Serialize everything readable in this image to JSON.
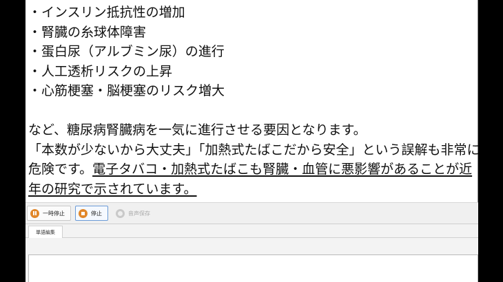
{
  "document": {
    "bullets": [
      "・インスリン抵抗性の増加",
      "・腎臓の糸球体障害",
      "・蛋白尿（アルブミン尿）の進行",
      "・人工透析リスクの上昇",
      "・心筋梗塞・脳梗塞のリスク増大"
    ],
    "paragraph_line1": "など、糖尿病腎臓病を一気に進行させる要因となります。",
    "paragraph_line2": "「本数が少ないから大丈夫」「加熱式たばこだから安全」という誤解も非常に",
    "paragraph_line3_plain": "危険です。",
    "paragraph_line3_underlined": "電子タバコ・加熱式たばこも腎臓・血管に悪影響があることが近",
    "paragraph_line4_underlined": "年の研究で示されています。"
  },
  "toolbar": {
    "pause_label": "一時停止",
    "stop_label": "停止",
    "save_audio_label": "音声保存"
  },
  "tabs": {
    "word_edit_label": "単語編集"
  },
  "colors": {
    "accent_orange": "#e1872a",
    "focus_blue": "#6a9ad6"
  }
}
